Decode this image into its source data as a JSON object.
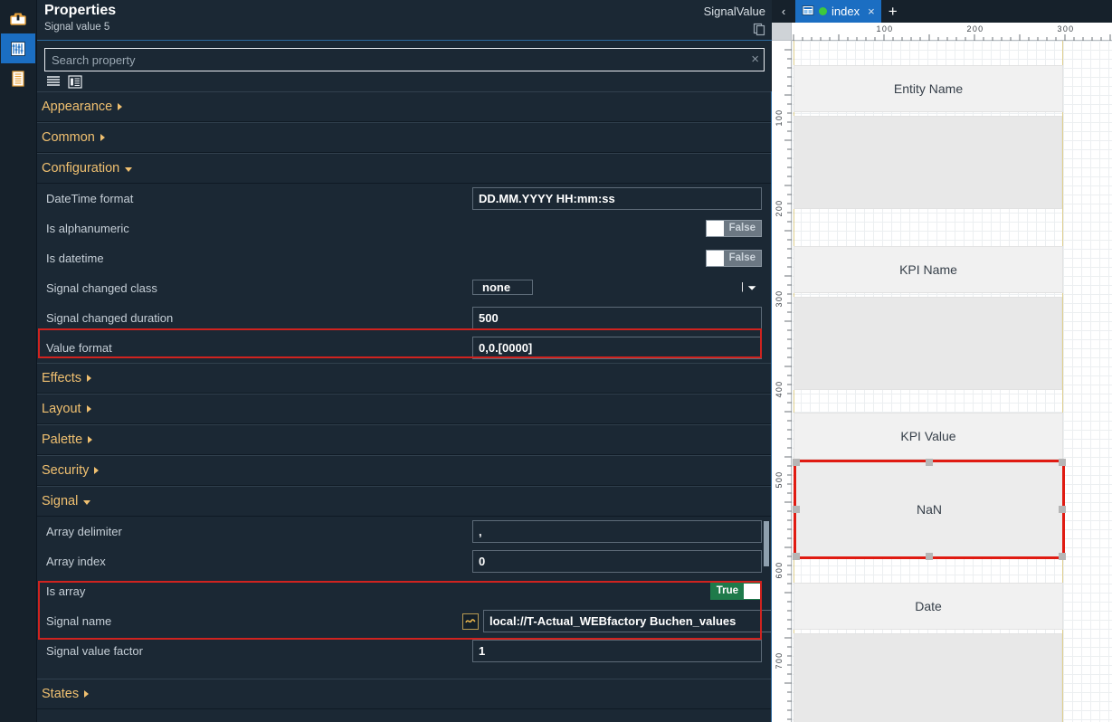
{
  "rail": {
    "items": [
      {
        "name": "toolbox-icon",
        "title": "Toolbox"
      },
      {
        "name": "properties-icon",
        "title": "Properties"
      },
      {
        "name": "list-icon",
        "title": "Elements"
      }
    ]
  },
  "properties": {
    "title": "Properties",
    "subtitle": "Signal value 5",
    "type_label": "SignalValue",
    "copy_icon": "copy-icon",
    "search": {
      "placeholder": "Search property",
      "value": "",
      "clear_label": "×"
    },
    "view_modes": [
      {
        "name": "list-view-icon"
      },
      {
        "name": "grouped-view-icon"
      }
    ],
    "groups": [
      {
        "label": "Appearance",
        "expanded": false
      },
      {
        "label": "Common",
        "expanded": false
      },
      {
        "label": "Configuration",
        "expanded": true
      },
      {
        "label": "Effects",
        "expanded": false
      },
      {
        "label": "Layout",
        "expanded": false
      },
      {
        "label": "Palette",
        "expanded": false
      },
      {
        "label": "Security",
        "expanded": false
      },
      {
        "label": "Signal",
        "expanded": true
      },
      {
        "label": "States",
        "expanded": false
      }
    ],
    "configuration_rows": [
      {
        "label": "DateTime format",
        "type": "text",
        "value": "DD.MM.YYYY HH:mm:ss"
      },
      {
        "label": "Is alphanumeric",
        "type": "toggle",
        "value": "False",
        "state": "off"
      },
      {
        "label": "Is datetime",
        "type": "toggle",
        "value": "False",
        "state": "off"
      },
      {
        "label": "Signal changed class",
        "type": "select",
        "value": "none"
      },
      {
        "label": "Signal changed duration",
        "type": "text",
        "value": "500"
      },
      {
        "label": "Value format",
        "type": "text",
        "value": "0,0.[0000]",
        "highlighted": true
      }
    ],
    "signal_rows": [
      {
        "label": "Array delimiter",
        "type": "text",
        "value": ","
      },
      {
        "label": "Array index",
        "type": "text",
        "value": "0"
      },
      {
        "label": "Is array",
        "type": "toggle",
        "value": "True",
        "state": "on",
        "highlighted": true
      },
      {
        "label": "Signal name",
        "type": "text-picker",
        "value": "local://T-Actual_WEBfactory Buchen_values",
        "picker_icon": "signal-browse-icon",
        "highlighted": true
      },
      {
        "label": "Signal value factor",
        "type": "text",
        "value": "1"
      }
    ],
    "highlight_color": "#d0231f"
  },
  "designer": {
    "tab_prev_label": "‹",
    "tab_add_label": "+",
    "tabs": [
      {
        "label": "index",
        "icon": "view-icon",
        "status": "modified",
        "close_label": "×",
        "active": true
      }
    ],
    "ruler": {
      "horizontal_ticks": [
        "100",
        "200",
        "300"
      ],
      "vertical_ticks": [
        "100",
        "200",
        "300",
        "400",
        "500",
        "600",
        "700"
      ]
    },
    "widgets": [
      {
        "label": "Entity Name",
        "kind": "label",
        "selected": false
      },
      {
        "label": "",
        "kind": "panel",
        "selected": false
      },
      {
        "label": "KPI Name",
        "kind": "label",
        "selected": false
      },
      {
        "label": "",
        "kind": "panel",
        "selected": false
      },
      {
        "label": "KPI Value",
        "kind": "label",
        "selected": false
      },
      {
        "label": "NaN",
        "kind": "signal-value",
        "selected": true
      },
      {
        "label": "Date",
        "kind": "label",
        "selected": false
      },
      {
        "label": "",
        "kind": "panel",
        "selected": false
      }
    ]
  }
}
